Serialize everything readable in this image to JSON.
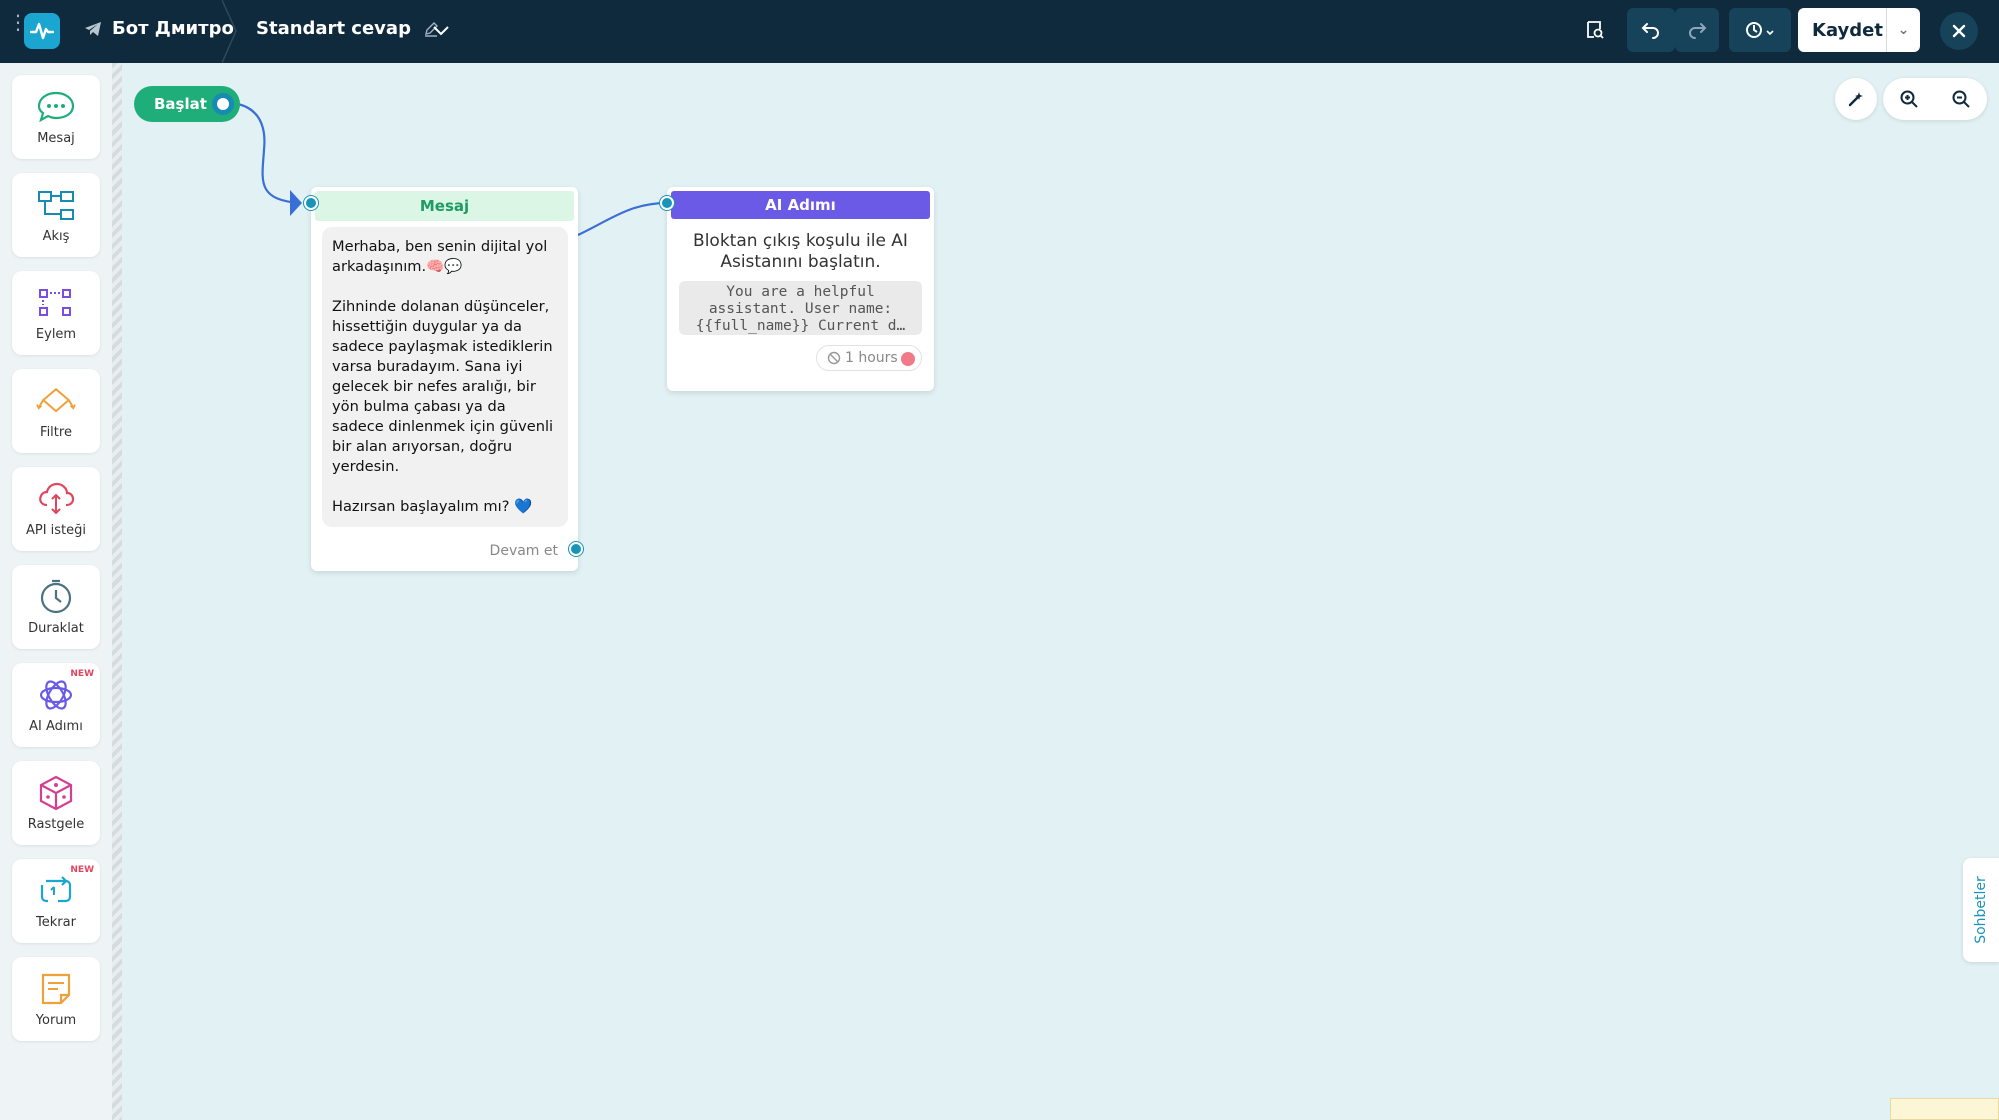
{
  "topbar": {
    "bot_name": "Бот Дмитро",
    "flow_name": "Standart cevap",
    "save_label": "Kaydet"
  },
  "sidebar": {
    "items": [
      {
        "label": "Mesaj",
        "icon": "message-icon",
        "color": "#1fae7a",
        "new": ""
      },
      {
        "label": "Akış",
        "icon": "flow-icon",
        "color": "#178bb2",
        "new": ""
      },
      {
        "label": "Eylem",
        "icon": "action-icon",
        "color": "#7a4ee0",
        "new": ""
      },
      {
        "label": "Filtre",
        "icon": "filter-icon",
        "color": "#f0a13c",
        "new": ""
      },
      {
        "label": "API isteği",
        "icon": "api-icon",
        "color": "#e0475e",
        "new": ""
      },
      {
        "label": "Duraklat",
        "icon": "timer-icon",
        "color": "#4d7184",
        "new": ""
      },
      {
        "label": "AI Adımı",
        "icon": "ai-icon",
        "color": "#6a5ae6",
        "new": "NEW"
      },
      {
        "label": "Rastgele",
        "icon": "dice-icon",
        "color": "#d53f92",
        "new": ""
      },
      {
        "label": "Tekrar",
        "icon": "repeat-icon",
        "color": "#1aa6d1",
        "new": "NEW"
      },
      {
        "label": "Yorum",
        "icon": "note-icon",
        "color": "#f0a13c",
        "new": ""
      }
    ]
  },
  "canvas": {
    "start_label": "Başlat",
    "message_node": {
      "title": "Mesaj",
      "paragraph1": "Merhaba, ben senin dijital yol arkadaşınım.🧠💬",
      "paragraph2": "Zihninde dolanan düşünceler, hissettiğin duygular ya da sadece paylaşmak istediklerin varsa buradayım. Sana iyi gelecek bir nefes aralığı, bir yön bulma çabası ya da sadece dinlenmek için güvenli bir alan arıyorsan, doğru yerdesin.",
      "paragraph3": "Hazırsan başlayalım mı? 💙",
      "continue_label": "Devam et"
    },
    "ai_node": {
      "title": "AI Adımı",
      "description": "Bloktan çıkış koşulu ile AI Asistanını başlatın.",
      "prompt": "You are a helpful assistant. User name: {{full_name}} Current d…",
      "timeout": "1 hours"
    },
    "chats_tab": "Sohbetler"
  },
  "colors": {
    "topbar": "#0e2a3c",
    "canvas": "#e2f2f4",
    "start": "#1fae7a",
    "message_header": "#dbf6e5",
    "ai_header": "#6a5ae6",
    "port": "#1894b8",
    "link": "#3b6fd8"
  }
}
